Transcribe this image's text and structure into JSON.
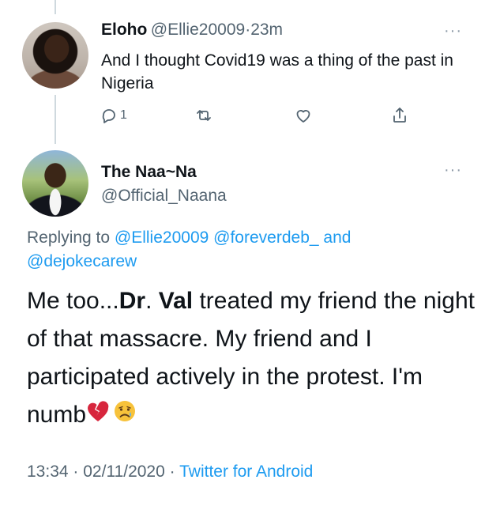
{
  "tweet1": {
    "name": "Eloho",
    "handle": "@Ellie20009",
    "time_sep": "·",
    "time": "23m",
    "text": "And I thought Covid19 was a thing of the past in Nigeria",
    "reply_count": "1"
  },
  "tweet2": {
    "name": "The Naa~Na",
    "handle": "@Official_Naana",
    "replying_prefix": "Replying to",
    "mention1": "@Ellie20009",
    "mention2": "@foreverdeb_",
    "and": "and",
    "mention3": "@dejokecarew",
    "text_a": "Me too...",
    "text_bold1": "Dr",
    "text_dot": ".",
    "text_bold2": "Val",
    "text_b": " treated my friend the night of that massacre. My friend and I participated actively in the protest. I'm numb",
    "time": "13:34",
    "sep": "·",
    "date": "02/11/2020",
    "source": "Twitter for Android"
  },
  "more_glyph": "···",
  "colors": {
    "accent": "#1d9bf0",
    "secondary": "#536471",
    "text": "#0f1419",
    "heart_emoji": "#d7263d",
    "sad_emoji": "#f7c23b"
  },
  "icons": [
    "reply-icon",
    "retweet-icon",
    "like-icon",
    "share-icon",
    "more-icon",
    "broken-heart-emoji",
    "sad-face-emoji"
  ]
}
